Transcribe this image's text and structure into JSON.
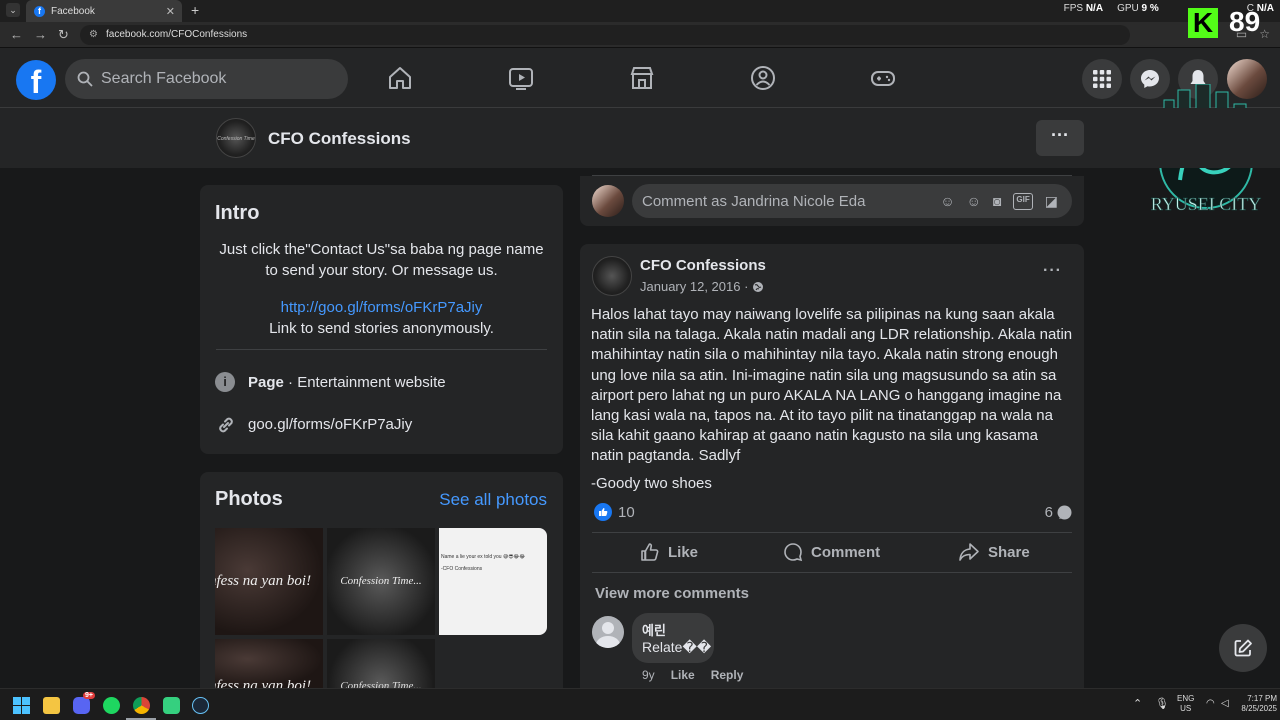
{
  "browser": {
    "tab_title": "Facebook",
    "tab_close": "✕",
    "new_tab": "+",
    "url": "facebook.com/CFOConfessions",
    "hud": {
      "fps_label": "FPS",
      "fps_value": "N/A",
      "gpu_label": "GPU",
      "gpu_value": "9 %",
      "cpu_label": "C",
      "cpu_value": "N/A"
    }
  },
  "overlay": {
    "k_letter": "K",
    "k_number": "89",
    "watermark_text": "RYUSEI CITY"
  },
  "fb": {
    "logo": "f",
    "search_placeholder": "Search Facebook",
    "nav_icons": [
      "home-icon",
      "video-icon",
      "marketplace-icon",
      "groups-icon",
      "gaming-icon"
    ],
    "right_icons": [
      "menu-grid-icon",
      "messenger-icon",
      "notifications-icon",
      "account-avatar"
    ]
  },
  "page": {
    "name": "CFO Confessions",
    "avatar_text": "Confession Time",
    "more": "···"
  },
  "intro": {
    "title": "Intro",
    "line1": "Just click the\"Contact Us\"sa baba ng page name",
    "line2": "to send your story. Or message us.",
    "link": "http://goo.gl/forms/oFKrP7aJiy",
    "link_caption": "Link to send stories anonymously.",
    "category_bold": "Page",
    "category_rest": " · Entertainment website",
    "website": "goo.gl/forms/oFKrP7aJiy"
  },
  "photos": {
    "title": "Photos",
    "see_all": "See all photos",
    "thumbs": [
      {
        "text": "nfess na yan boi!"
      },
      {
        "text": "Confession Time..."
      },
      {
        "text": "Name a lie your ex told you 😅😎😂😂",
        "sub": "-CFO Confessions"
      },
      {
        "text": "nfess na yan boi!"
      },
      {
        "text": "Confession Time..."
      }
    ]
  },
  "comment_box": {
    "placeholder": "Comment as Jandrina Nicole Eda"
  },
  "post": {
    "author": "CFO Confessions",
    "date": "January 12, 2016 ·",
    "body_lines": [
      "Halos lahat tayo may naiwang lovelife sa pilipinas na kung saan akala",
      "natin sila na talaga. Akala natin madali ang LDR relationship. Akala natin",
      "mahihintay natin sila o mahihintay nila tayo. Akala natin strong enough",
      "ung love nila sa atin. Ini-imagine natin sila ung magsusundo sa atin sa",
      "airport pero lahat ng un puro AKALA NA LANG o hanggang imagine na",
      "lang kasi wala na, tapos na. At ito tayo pilit na tinatanggap na wala na",
      "sila kahit gaano kahirap at gaano natin kagusto na sila ung kasama",
      "natin pagtanda. Sadlyf"
    ],
    "signature": "-Goody two shoes",
    "likes": "10",
    "comments_count": "6",
    "like_label": "Like",
    "comment_label": "Comment",
    "share_label": "Share",
    "view_more": "View more comments",
    "comment": {
      "author": "예린",
      "text": "Relate��",
      "time": "9y",
      "like": "Like",
      "reply": "Reply"
    }
  },
  "taskbar": {
    "discord_badge": "9+",
    "lang": "ENG",
    "region": "US",
    "time": "7:17 PM",
    "date": "8/25/2025"
  },
  "colors": {
    "fb_blue": "#1877f2",
    "link_blue": "#4599ff",
    "kick_green": "#53fc18",
    "card_bg": "#242526",
    "page_bg": "#18191a"
  }
}
